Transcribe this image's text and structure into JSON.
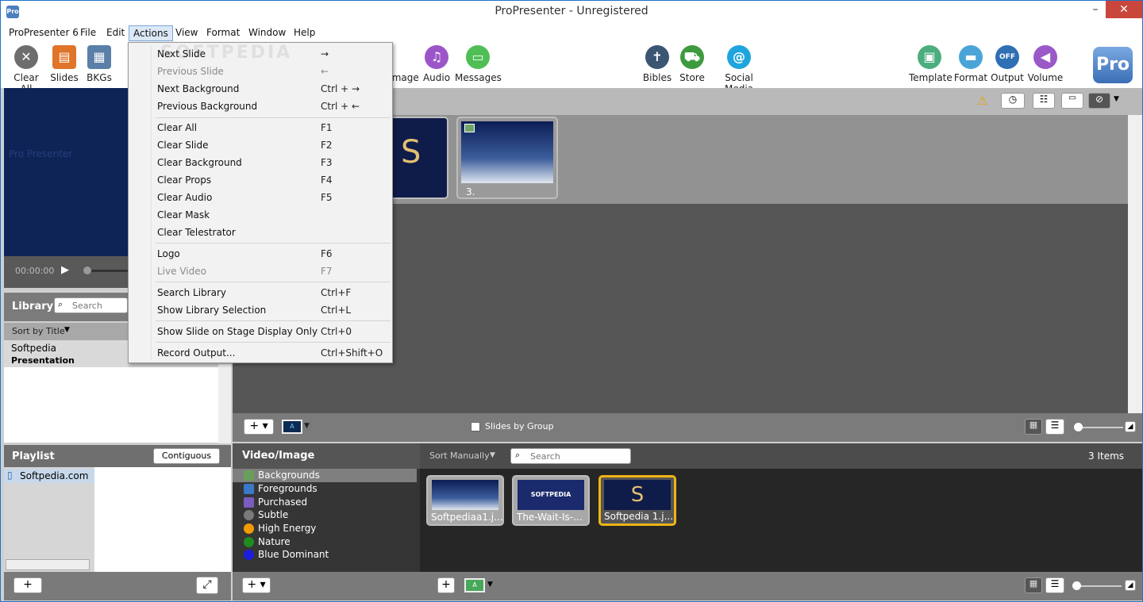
{
  "window": {
    "title": "ProPresenter - Unregistered",
    "app_icon": "Pro",
    "min": "–",
    "max": "□",
    "close": "✕"
  },
  "menubar": [
    "ProPresenter 6",
    "File",
    "Edit",
    "Actions",
    "View",
    "Format",
    "Window",
    "Help"
  ],
  "toolbar": {
    "left": [
      {
        "label": "Clear All",
        "icon": "clear-all-icon",
        "color": "#6d6d6d"
      },
      {
        "label": "Slides",
        "icon": "clear-slides-icon",
        "color": "#e0742a"
      },
      {
        "label": "BKGs",
        "icon": "clear-bkgs-icon",
        "color": "#5a7fa8"
      }
    ],
    "mid": [
      {
        "label": "Image",
        "icon": "image-icon",
        "color": "#59b85a"
      },
      {
        "label": "Audio",
        "icon": "audio-icon",
        "color": "#9c55c9"
      },
      {
        "label": "Messages",
        "icon": "messages-icon",
        "color": "#4fbf55"
      },
      {
        "label": "Bibles",
        "icon": "bibles-icon",
        "color": "#3b5573"
      },
      {
        "label": "Store",
        "icon": "store-icon",
        "color": "#3d9a3f"
      },
      {
        "label": "Social Media",
        "icon": "social-media-icon",
        "color": "#1ea5dd"
      }
    ],
    "right": [
      {
        "label": "Template",
        "icon": "template-icon",
        "color": "#4cae7e"
      },
      {
        "label": "Format",
        "icon": "format-icon",
        "color": "#4aa4d8"
      },
      {
        "label": "Output",
        "icon": "output-icon",
        "color": "#2f6fb4"
      },
      {
        "label": "Volume",
        "icon": "volume-icon",
        "color": "#9a58c8"
      }
    ],
    "logo": "Pro"
  },
  "actions_menu": [
    {
      "label": "Next Slide",
      "shortcut": "→",
      "disabled": false
    },
    {
      "label": "Previous Slide",
      "shortcut": "←",
      "disabled": true
    },
    {
      "label": "Next Background",
      "shortcut": "Ctrl + →",
      "disabled": false
    },
    {
      "label": "Previous Background",
      "shortcut": "Ctrl + ←",
      "disabled": false
    },
    {
      "label": "Clear All",
      "shortcut": "F1",
      "disabled": false
    },
    {
      "label": "Clear Slide",
      "shortcut": "F2",
      "disabled": false
    },
    {
      "label": "Clear Background",
      "shortcut": "F3",
      "disabled": false
    },
    {
      "label": "Clear Props",
      "shortcut": "F4",
      "disabled": false
    },
    {
      "label": "Clear Audio",
      "shortcut": "F5",
      "disabled": false
    },
    {
      "label": "Clear Mask",
      "shortcut": "",
      "disabled": false
    },
    {
      "label": "Clear Telestrator",
      "shortcut": "",
      "disabled": false
    },
    {
      "label": "Logo",
      "shortcut": "F6",
      "disabled": false
    },
    {
      "label": "Live Video",
      "shortcut": "F7",
      "disabled": true
    },
    {
      "label": "Search Library",
      "shortcut": "Ctrl+F",
      "disabled": false
    },
    {
      "label": "Show Library Selection",
      "shortcut": "Ctrl+L",
      "disabled": false
    },
    {
      "label": "Show Slide on Stage Display Only",
      "shortcut": "Ctrl+0",
      "disabled": false
    },
    {
      "label": "Record Output...",
      "shortcut": "Ctrl+Shift+O",
      "disabled": false
    }
  ],
  "preview": {
    "timecode": "00:00:00",
    "watermark": "Pro Presenter"
  },
  "library": {
    "title": "Library",
    "search_placeholder": "Search",
    "sort": "Sort by Title",
    "items": [
      {
        "title": "Softpedia",
        "subtitle": "Presentation"
      }
    ]
  },
  "playlist": {
    "title": "Playlist",
    "mode": "Contiguous",
    "items": [
      "Softpedia.com"
    ]
  },
  "slides": {
    "items": [
      {
        "label": ""
      },
      {
        "label": "3."
      }
    ],
    "group_toggle": "Slides by Group"
  },
  "video_image": {
    "title": "Video/Image",
    "sort": "Sort Manually",
    "search_placeholder": "Search",
    "count": "3 Items",
    "categories": [
      {
        "label": "Backgrounds",
        "color": "#6a9f5a",
        "selected": true
      },
      {
        "label": "Foregrounds",
        "color": "#3a78c8",
        "selected": false
      },
      {
        "label": "Purchased",
        "color": "#7a5bc0",
        "selected": false
      },
      {
        "label": "Subtle",
        "color": "#7a7a7a",
        "selected": false
      },
      {
        "label": "High Energy",
        "color": "#f39a00",
        "selected": false
      },
      {
        "label": "Nature",
        "color": "#1f8c1f",
        "selected": false
      },
      {
        "label": "Blue Dominant",
        "color": "#1d1ddd",
        "selected": false
      }
    ],
    "media": [
      {
        "label": "Softpediaa1.j...",
        "selected": false
      },
      {
        "label": "The-Wait-Is-...",
        "selected": false
      },
      {
        "label": "Softpedia 1.j...",
        "selected": true
      }
    ]
  },
  "watermark": "SOFTPEDIA"
}
